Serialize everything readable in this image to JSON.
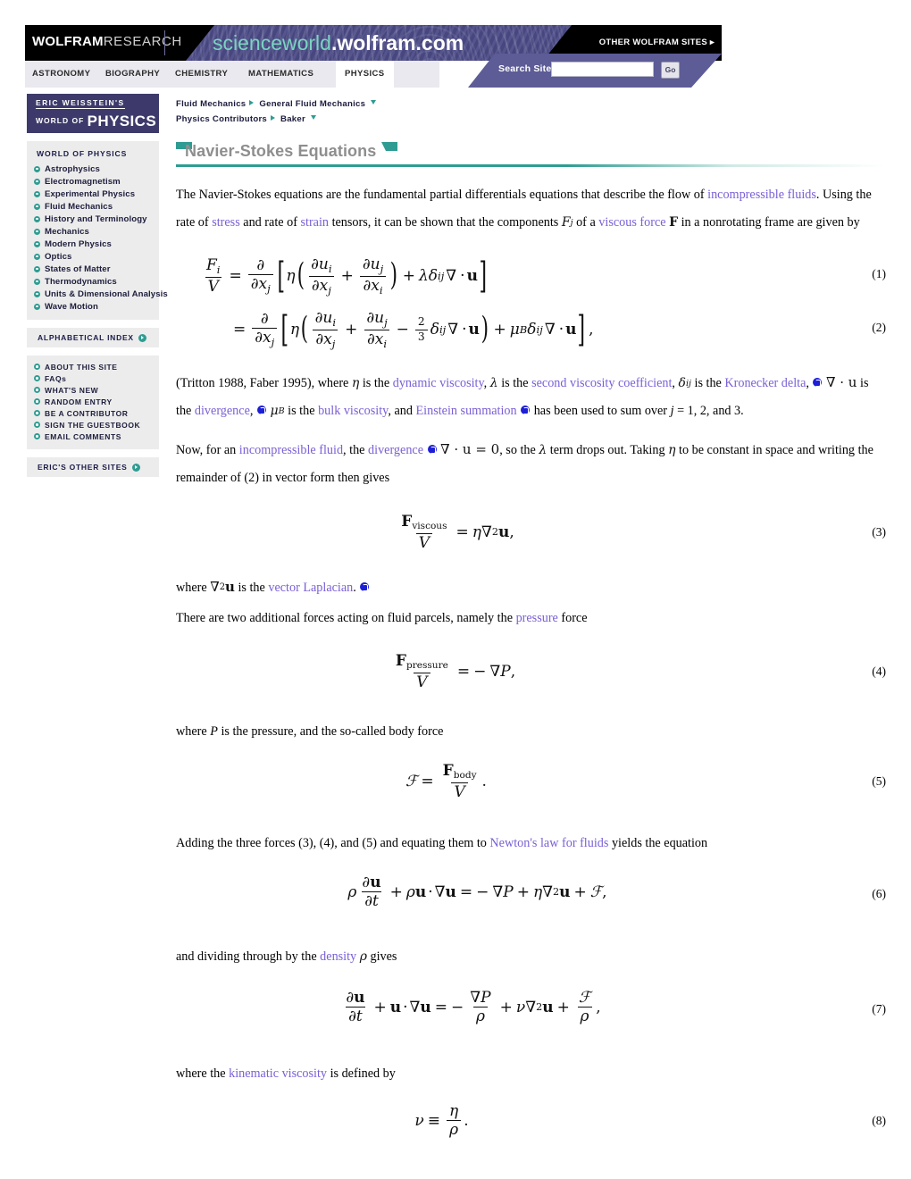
{
  "header": {
    "logo_bold": "WOLFRAM",
    "logo_light": "RESEARCH",
    "site_title_prefix": "scienceworld",
    "site_title_suffix": ".wolfram.com",
    "other_sites": "OTHER WOLFRAM SITES ▸",
    "tabs": [
      {
        "label": "ASTRONOMY",
        "active": false
      },
      {
        "label": "BIOGRAPHY",
        "active": false
      },
      {
        "label": "CHEMISTRY",
        "active": false
      },
      {
        "label": "MATHEMATICS",
        "active": false
      },
      {
        "label": "PHYSICS",
        "active": true
      }
    ],
    "search_label": "Search Site",
    "search_value": "",
    "search_placeholder": "",
    "search_button": "Go"
  },
  "sidebar": {
    "banner_line1": "ERIC WEISSTEIN'S",
    "banner_line2_small": "WORLD OF",
    "banner_line2_big": "PHYSICS",
    "section_heading": "WORLD OF PHYSICS",
    "topics": [
      "Astrophysics",
      "Electromagnetism",
      "Experimental Physics",
      "Fluid Mechanics",
      "History and Terminology",
      "Mechanics",
      "Modern Physics",
      "Optics",
      "States of Matter",
      "Thermodynamics",
      "Units & Dimensional Analysis",
      "Wave Motion"
    ],
    "alphabetical_index": "ALPHABETICAL INDEX",
    "site_links": [
      "ABOUT THIS SITE",
      "FAQs",
      "WHAT'S NEW",
      "RANDOM ENTRY",
      "BE A CONTRIBUTOR",
      "SIGN THE GUESTBOOK",
      "EMAIL COMMENTS"
    ],
    "other_sites": "ERIC'S OTHER SITES"
  },
  "breadcrumb": {
    "row1_a": "Fluid Mechanics",
    "row1_b": "General Fluid Mechanics",
    "row2_a": "Physics Contributors",
    "row2_b": "Baker"
  },
  "page": {
    "title": "Navier-Stokes Equations"
  },
  "body": {
    "p1_a": "The Navier-Stokes equations are the fundamental partial differentials equations that describe the flow of ",
    "p1_link1": "incompressible fluids",
    "p1_b": ". Using the rate of ",
    "p1_link2": "stress",
    "p1_c": " and rate of ",
    "p1_link3": "strain",
    "p1_d": " tensors, it can be shown that the components ",
    "p1_math1": "F",
    "p1_math1_sub": "j",
    "p1_e": " of a ",
    "p1_link4": "viscous force",
    "p1_math2": "F",
    "p1_f": " in a nonrotating frame are given by",
    "p2_a": "(Tritton 1988, Faber 1995), where ",
    "p2_eta": "η",
    "p2_b": " is the ",
    "p2_link1": "dynamic viscosity",
    "p2_c": ", ",
    "p2_lambda": "λ",
    "p2_d": " is the ",
    "p2_link2": "second viscosity coefficient",
    "p2_e": ", ",
    "p2_delta": "δ",
    "p2_delta_sub": "ij",
    "p2_f": " is the ",
    "p2_link3": "Kronecker delta",
    "p2_g": ", ",
    "p2_div": "∇ · u",
    "p2_h": " is the ",
    "p2_link4": "divergence",
    "p2_i": ", ",
    "p2_mub": "μ",
    "p2_mub_sub": "B",
    "p2_j": " is the ",
    "p2_link5": "bulk viscosity",
    "p2_k": ", and ",
    "p2_link6": "Einstein summation",
    "p2_l": " has been used to sum over ",
    "p2_m": "j",
    "p2_n": " = 1, 2, and 3.",
    "p3_a": "Now, for an ",
    "p3_link1": "incompressible fluid",
    "p3_b": ", the ",
    "p3_link2": "divergence",
    "p3_math": "∇ · u = 0",
    "p3_c": ", so the ",
    "p3_lambda": "λ",
    "p3_d": " term drops out. Taking ",
    "p3_eta": "η",
    "p3_e": " to be constant in space and writing the remainder of (2) in vector form then gives",
    "p4_a": "where ",
    "p4_math": "∇²u",
    "p4_b": " is the ",
    "p4_link": "vector Laplacian",
    "p4_c": ".",
    "p5_a": "There are two additional forces acting on fluid parcels, namely the ",
    "p5_link": "pressure",
    "p5_b": " force",
    "p6_a": "where ",
    "p6_P": "P",
    "p6_b": " is the pressure, and the so-called body force",
    "p7_a": "Adding the three forces (3), (4), and (5) and equating them to ",
    "p7_link": "Newton's law for fluids",
    "p7_b": " yields the equation",
    "p8_a": "and dividing through by the ",
    "p8_link": "density",
    "p8_rho": "ρ",
    "p8_b": " gives",
    "p9_a": "where the ",
    "p9_link": "kinematic viscosity",
    "p9_b": " is defined by"
  },
  "equations": {
    "n1": "(1)",
    "n2": "(2)",
    "n3": "(3)",
    "n4": "(4)",
    "n5": "(5)",
    "n6": "(6)",
    "n7": "(7)",
    "n8": "(8)",
    "eq1_latex": "F_i/V = ∂/∂x_j [ η ( ∂u_i/∂x_j + ∂u_j/∂x_i ) + λδ_ij ∇·u ]",
    "eq2_latex": "= ∂/∂x_j [ η ( ∂u_i/∂x_j + ∂u_j/∂x_i − (2/3)δ_ij ∇·u ) + μ_Bδ_ij ∇·u ],",
    "eq3_latex": "F_viscous/V = η∇²u,",
    "eq4_latex": "F_pressure/V = −∇P,",
    "eq5_latex": "ℱ = F_body/V.",
    "eq6_latex": "ρ ∂u/∂t + ρu·∇u = −∇P + η∇²u + ℱ,",
    "eq7_latex": "∂u/∂t + u·∇u = −∇P/ρ + ν∇²u + ℱ/ρ,",
    "eq8_latex": "ν ≡ η/ρ."
  },
  "colors": {
    "accent_teal": "#2e9c92",
    "header_purple": "#4b4a86",
    "link_violet": "#7a5fd6",
    "sidebar_navy": "#3d3a6b"
  }
}
